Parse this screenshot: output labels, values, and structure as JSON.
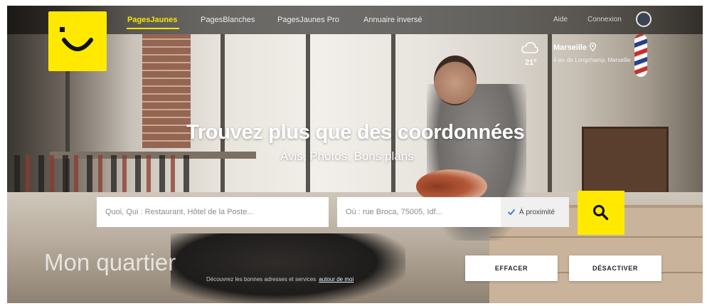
{
  "nav": {
    "items": [
      {
        "label": "PagesJaunes",
        "active": true
      },
      {
        "label": "PagesBlanches",
        "active": false
      },
      {
        "label": "PagesJaunes Pro",
        "active": false
      },
      {
        "label": "Annuaire inversé",
        "active": false
      }
    ],
    "help": "Aide",
    "account": "Connexion"
  },
  "weather": {
    "icon": "cloud-icon",
    "temperature": "21°",
    "city": "Marseille",
    "address": "4 av. de Longchamp, Marseille"
  },
  "hero": {
    "headline": "Trouvez plus que des coordonnées",
    "subhead": "Avis, Photos, Bons plans"
  },
  "search": {
    "what_placeholder": "Quoi, Qui : Restaurant, Hôtel de la Poste...",
    "where_placeholder": "Où : rue Broca, 75005, Idf...",
    "proximity_label": "À proximité",
    "proximity_checked": true
  },
  "quarter": {
    "title": "Mon quartier",
    "subtitle": "Découvrez les bonnes adresses et services",
    "link": "autour de moi"
  },
  "actions": {
    "clear_label": "EFFACER",
    "disable_label": "DÉSACTIVER"
  },
  "colors": {
    "brand_yellow": "#ffe900",
    "nav_active": "#f5e600"
  }
}
